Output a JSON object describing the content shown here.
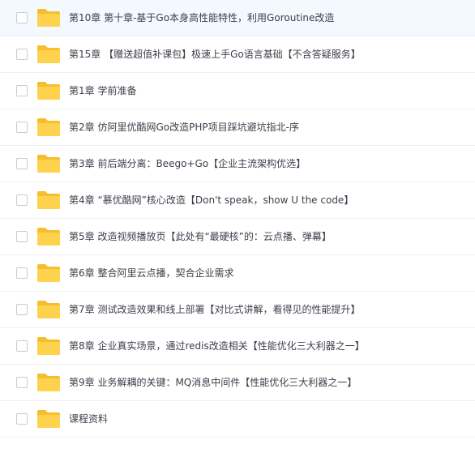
{
  "file_list": {
    "items": [
      {
        "name": "第10章 第十章-基于Go本身高性能特性，利用Goroutine改造",
        "type": "folder",
        "icon": "folder-icon"
      },
      {
        "name": "第15章 【赠送超值补课包】极速上手Go语言基础【不含答疑服务】",
        "type": "folder",
        "icon": "folder-icon"
      },
      {
        "name": "第1章 学前准备",
        "type": "folder",
        "icon": "folder-icon"
      },
      {
        "name": "第2章 仿阿里优酷网Go改造PHP项目踩坑避坑指北-序",
        "type": "folder",
        "icon": "folder-icon"
      },
      {
        "name": "第3章 前后端分离：Beego+Go【企业主流架构优选】",
        "type": "folder",
        "icon": "folder-icon"
      },
      {
        "name": "第4章 “慕优酷网”核心改造【Don't speak，show U the code】",
        "type": "folder",
        "icon": "folder-icon"
      },
      {
        "name": "第5章 改造视频播放页【此处有“最硬核”的：云点播、弹幕】",
        "type": "folder",
        "icon": "folder-icon"
      },
      {
        "name": "第6章 整合阿里云点播，契合企业需求",
        "type": "folder",
        "icon": "folder-icon"
      },
      {
        "name": "第7章 测试改造效果和线上部署【对比式讲解，看得见的性能提升】",
        "type": "folder",
        "icon": "folder-icon"
      },
      {
        "name": "第8章 企业真实场景，通过redis改造相关【性能优化三大利器之一】",
        "type": "folder",
        "icon": "folder-icon"
      },
      {
        "name": "第9章 业务解耦的关键：MQ消息中间件【性能优化三大利器之一】",
        "type": "folder",
        "icon": "folder-icon"
      },
      {
        "name": "课程资料",
        "type": "folder",
        "icon": "folder-icon"
      }
    ]
  },
  "colors": {
    "folder_main": "#ffd24d",
    "folder_back": "#f5be2e",
    "text": "#3b3f4a",
    "row_border": "#eef0f4",
    "row_highlight": "#f4f8ff",
    "checkbox_border": "#c7cbd3"
  }
}
